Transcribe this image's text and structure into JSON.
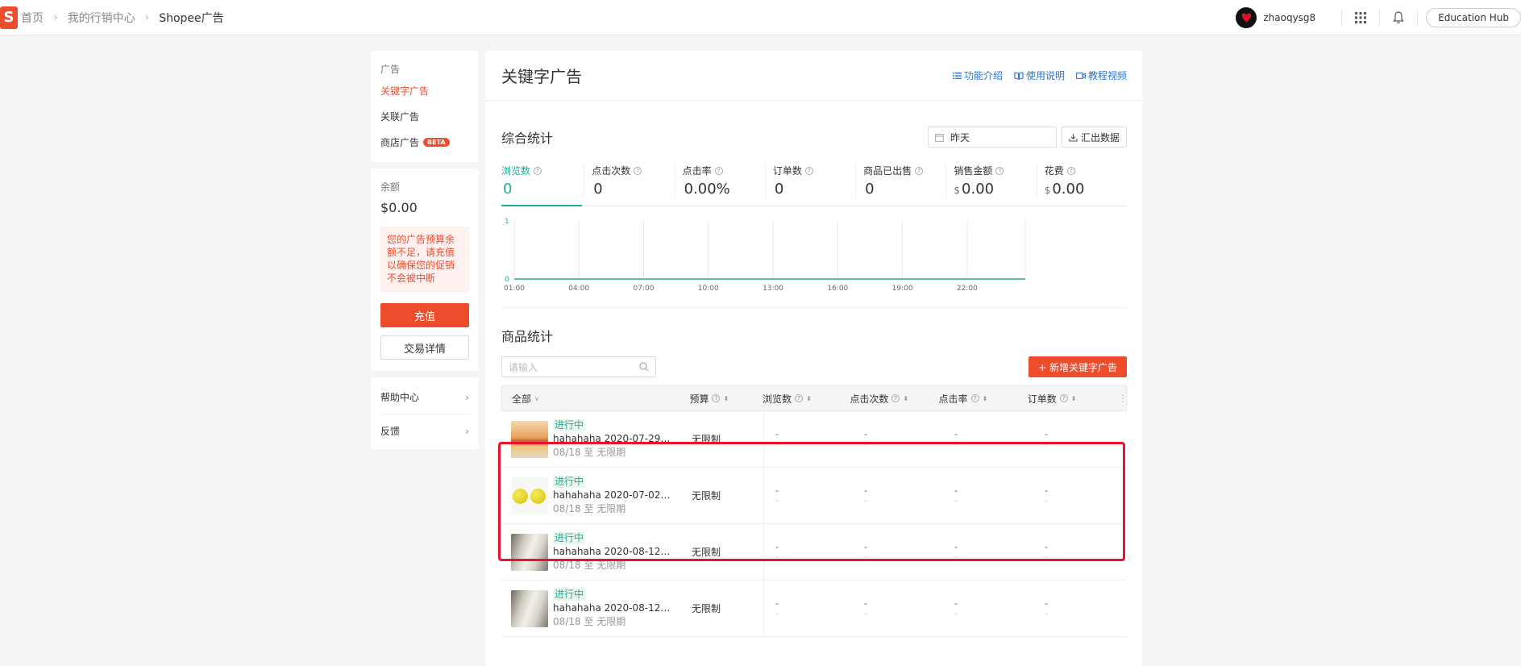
{
  "topbar": {
    "logo_letter": "S",
    "breadcrumbs": [
      "首页",
      "我的行销中心",
      "Shopee广告"
    ],
    "username": "zhaoqysg8",
    "education_hub": "Education Hub"
  },
  "sidebar": {
    "ads_title": "广告",
    "items": [
      {
        "label": "关键字广告",
        "active": true
      },
      {
        "label": "关联广告",
        "active": false
      },
      {
        "label": "商店广告",
        "active": false,
        "badge": "BETA"
      }
    ],
    "balance_label": "余额",
    "balance": "$0.00",
    "warning": "您的广告预算余额不足，请充值以确保您的促销不会被中断",
    "recharge": "充值",
    "transactions": "交易详情",
    "help_center": "帮助中心",
    "feedback": "反馈"
  },
  "main": {
    "title": "关键字广告",
    "help_links": [
      "功能介绍",
      "使用说明",
      "教程视频"
    ],
    "overview_title": "综合统计",
    "date_value": "昨天",
    "export_label": "汇出数据",
    "metrics": [
      {
        "label": "浏览数",
        "value": "0",
        "currency": ""
      },
      {
        "label": "点击次数",
        "value": "0",
        "currency": ""
      },
      {
        "label": "点击率",
        "value": "0.00%",
        "currency": ""
      },
      {
        "label": "订单数",
        "value": "0",
        "currency": ""
      },
      {
        "label": "商品已出售",
        "value": "0",
        "currency": ""
      },
      {
        "label": "销售金额",
        "value": "0.00",
        "currency": "$"
      },
      {
        "label": "花费",
        "value": "0.00",
        "currency": "$"
      }
    ],
    "product_title": "商品统计",
    "search_placeholder": "请输入",
    "add_button": "+ 新增关键字广告",
    "columns": {
      "all": "全部",
      "budget": "预算",
      "views": "浏览数",
      "clicks": "点击次数",
      "ctr": "点击率",
      "orders": "订单数"
    },
    "rows": [
      {
        "status": "进行中",
        "name": "hahahaha 2020-07-29 12...",
        "period": "08/18 至 无限期",
        "budget": "无限制",
        "thumb": "food-image"
      },
      {
        "status": "进行中",
        "name": "hahahaha 2020-07-02 03...",
        "period": "08/18 至 无限期",
        "budget": "无限制",
        "thumb": "lemon-image"
      },
      {
        "status": "进行中",
        "name": "hahahaha 2020-08-12 15...",
        "period": "08/18 至 无限期",
        "budget": "无限制",
        "thumb": "book-image"
      },
      {
        "status": "进行中",
        "name": "hahahaha 2020-08-12 15...",
        "period": "08/18 至 无限期",
        "budget": "无限制",
        "thumb": "book-image"
      }
    ],
    "empty_value": "-"
  },
  "chart_data": {
    "type": "line",
    "x": [
      "01:00",
      "04:00",
      "07:00",
      "10:00",
      "13:00",
      "16:00",
      "19:00",
      "22:00"
    ],
    "series": [
      {
        "values": [
          0,
          0,
          0,
          0,
          0,
          0,
          0,
          0
        ]
      }
    ],
    "ylim": [
      0,
      1
    ],
    "yticks": [
      "0",
      "1"
    ],
    "grid": true,
    "color": "#26aa99"
  },
  "colors": {
    "brand": "#ee4d2d",
    "active": "#26aa99",
    "link": "#2673dd",
    "highlight": "#e8142c"
  }
}
